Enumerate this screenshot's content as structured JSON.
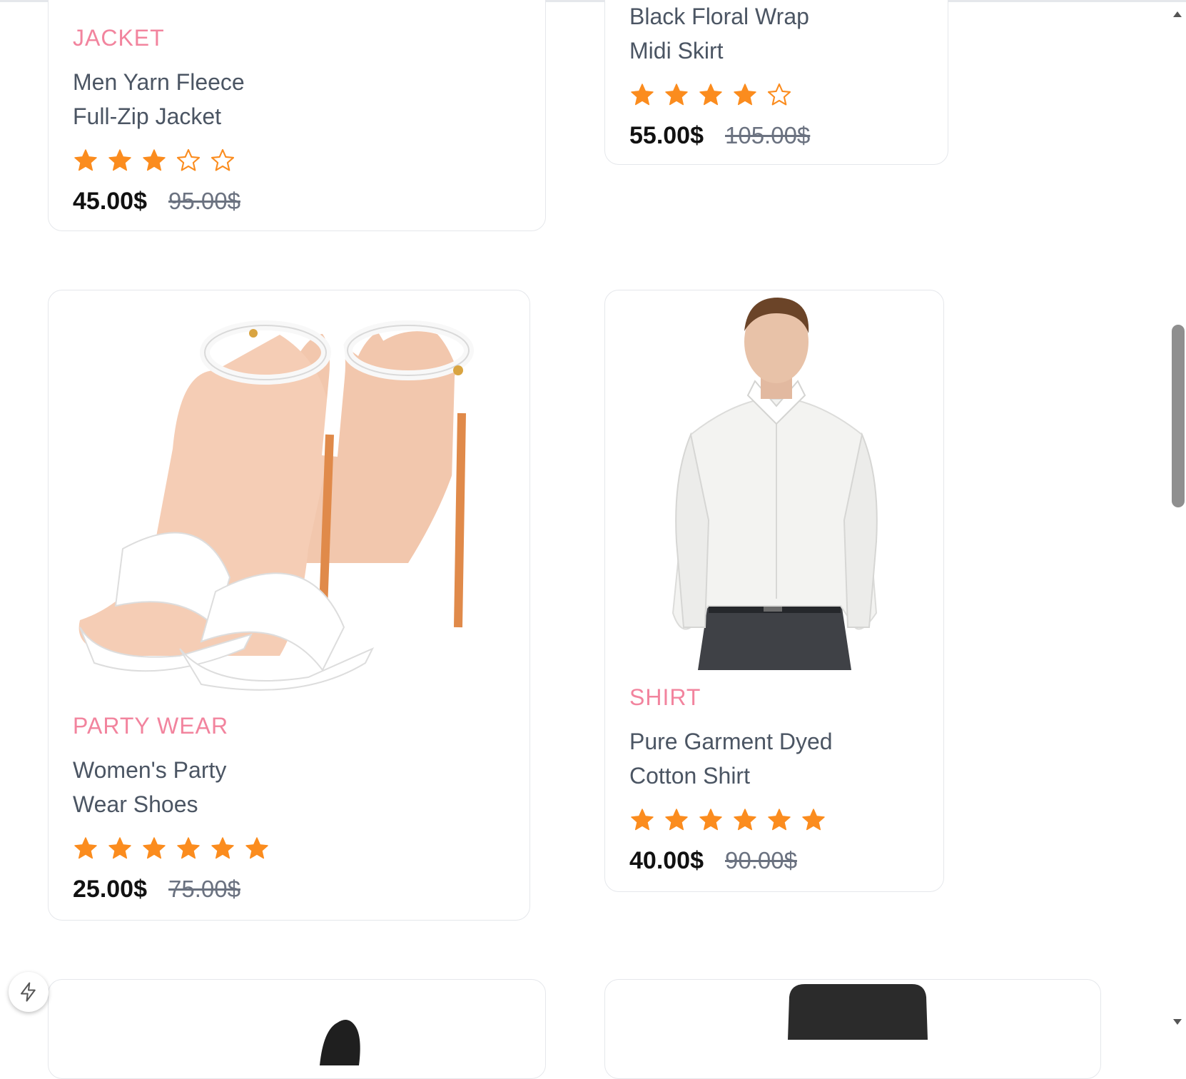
{
  "accent": "#f2849e",
  "star_color": "#fb8c1e",
  "products": [
    {
      "category": "JACKET",
      "title_lines": [
        "Men Yarn Fleece",
        "Full-Zip Jacket"
      ],
      "rating": 3,
      "price": "45.00$",
      "old_price": "95.00$"
    },
    {
      "category": "",
      "title_lines": [
        "Black Floral Wrap",
        "Midi Skirt"
      ],
      "rating": 4,
      "price": "55.00$",
      "old_price": "105.00$"
    },
    {
      "category": "PARTY WEAR",
      "title_lines": [
        "Women's Party",
        "Wear Shoes"
      ],
      "rating": 6,
      "price": "25.00$",
      "old_price": "75.00$",
      "image": "white-heels"
    },
    {
      "category": "SHIRT",
      "title_lines": [
        "Pure Garment Dyed",
        "Cotton Shirt"
      ],
      "rating": 6,
      "price": "40.00$",
      "old_price": "90.00$",
      "image": "man-white-shirt"
    }
  ],
  "star_slots": {
    "p0": 5,
    "p1": 5,
    "p2": 6,
    "p3": 6
  },
  "icons": {
    "fab": "lightning-icon",
    "scroll_up": "arrow-up-icon",
    "scroll_down": "arrow-down-icon"
  }
}
